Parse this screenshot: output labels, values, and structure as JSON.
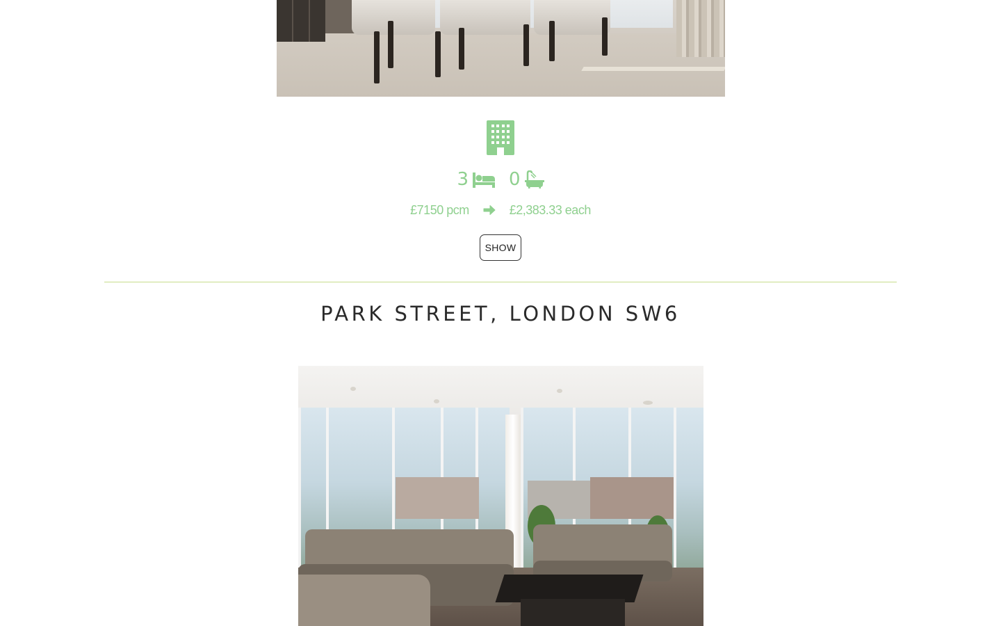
{
  "listing_1": {
    "bedrooms": "3",
    "bathrooms": "0",
    "rent": "£7150 pcm",
    "per_person": "£2,383.33 each",
    "show_label": "SHOW"
  },
  "listing_2": {
    "title": "PARK STREET, LONDON SW6"
  },
  "icons": {
    "property_type": "building-icon",
    "bedrooms": "bed-icon",
    "bathrooms": "bath-icon",
    "price_split": "arrow-right-icon"
  },
  "colors": {
    "accent_green": "#8fd08f",
    "divider_green": "#c7dd8b",
    "title_text": "#2a2a2a"
  }
}
